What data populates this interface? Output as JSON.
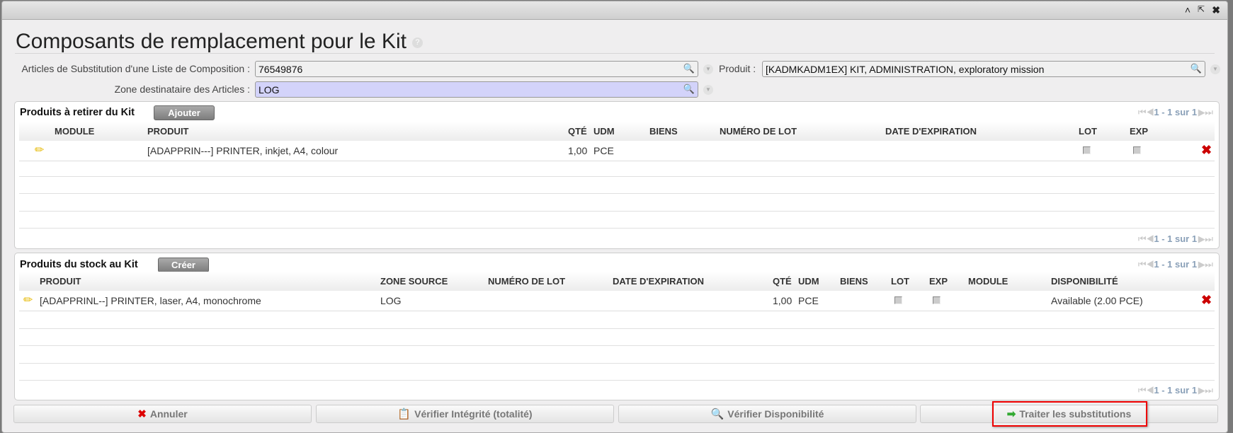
{
  "window": {
    "icons": [
      "collapse-icon",
      "popout-icon",
      "close-icon"
    ]
  },
  "title": "Composants de remplacement pour le Kit",
  "help": "?",
  "form": {
    "substitution_label": "Articles de Substitution d'une Liste de Composition :",
    "substitution_value": "76549876",
    "product_label": "Produit :",
    "product_value": "[KADMKADM1EX] KIT, ADMINISTRATION, exploratory mission",
    "zone_label": "Zone destinataire des Articles :",
    "zone_value": "LOG"
  },
  "remove_panel": {
    "title": "Produits à retirer du Kit",
    "button": "Ajouter",
    "pager": "1 - 1 sur 1",
    "columns": [
      "MODULE",
      "PRODUIT",
      "QTÉ",
      "UDM",
      "BIENS",
      "NUMÉRO DE LOT",
      "DATE D'EXPIRATION",
      "LOT",
      "EXP"
    ],
    "rows": [
      {
        "module": "",
        "produit": "[ADAPPRIN---] PRINTER, inkjet, A4, colour",
        "qte": "1,00",
        "udm": "PCE",
        "biens": "",
        "lot_num": "",
        "date": ""
      }
    ]
  },
  "stock_panel": {
    "title": "Produits du stock au Kit",
    "button": "Créer",
    "pager": "1 - 1 sur 1",
    "columns": [
      "PRODUIT",
      "ZONE SOURCE",
      "NUMÉRO DE LOT",
      "DATE D'EXPIRATION",
      "QTÉ",
      "UDM",
      "BIENS",
      "LOT",
      "EXP",
      "MODULE",
      "DISPONIBILITÉ"
    ],
    "rows": [
      {
        "produit": "[ADAPPRINL--] PRINTER, laser, A4, monochrome",
        "zone": "LOG",
        "lot_num": "",
        "date": "",
        "qte": "1,00",
        "udm": "PCE",
        "biens": "",
        "module": "",
        "dispo": "Available (2.00 PCE)"
      }
    ]
  },
  "footer": {
    "cancel": "Annuler",
    "check_integrity": "Vérifier Intégrité (totalité)",
    "check_availability": "Vérifier Disponibilité",
    "process": "Traiter les substitutions"
  },
  "colors": {
    "highlight": "#e00000",
    "zone_input": "#d3d3fa"
  }
}
